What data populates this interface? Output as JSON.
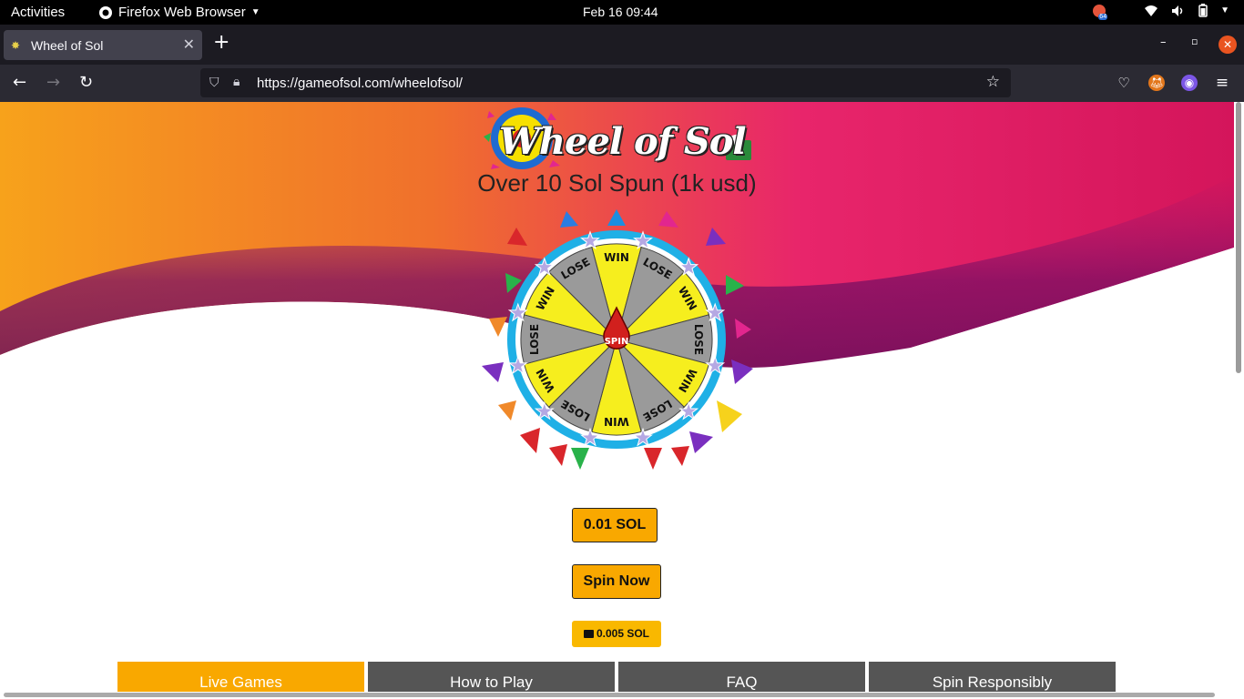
{
  "system": {
    "activities": "Activities",
    "app_name": "Firefox Web Browser",
    "clock": "Feb 16  09:44",
    "notification_count": "64"
  },
  "browser": {
    "tab_title": "Wheel of Sol",
    "url": "https://gameofsol.com/wheelofsol/"
  },
  "page": {
    "logo_text": "Wheel of Sol",
    "subtitle": "Over 10 Sol Spun (1k usd)",
    "wheel": {
      "center_label": "SPIN",
      "segments": [
        "WIN",
        "LOSE",
        "WIN",
        "LOSE",
        "WIN",
        "LOSE",
        "WIN",
        "LOSE",
        "WIN",
        "LOSE",
        "WIN",
        "LOSE"
      ]
    },
    "bet_amount_button": "0.01 SOL",
    "spin_button": "Spin Now",
    "wallet_balance": "0.005 SOL",
    "tabs": [
      "Live Games",
      "How to Play",
      "FAQ",
      "Spin Responsibly"
    ],
    "active_tab": "Live Games"
  },
  "colors": {
    "accent": "#f9a800",
    "tab_inactive": "#555555",
    "hero_orange": "#f7a21b",
    "hero_pink": "#e8256b",
    "hero_purple": "#7c0f63"
  }
}
